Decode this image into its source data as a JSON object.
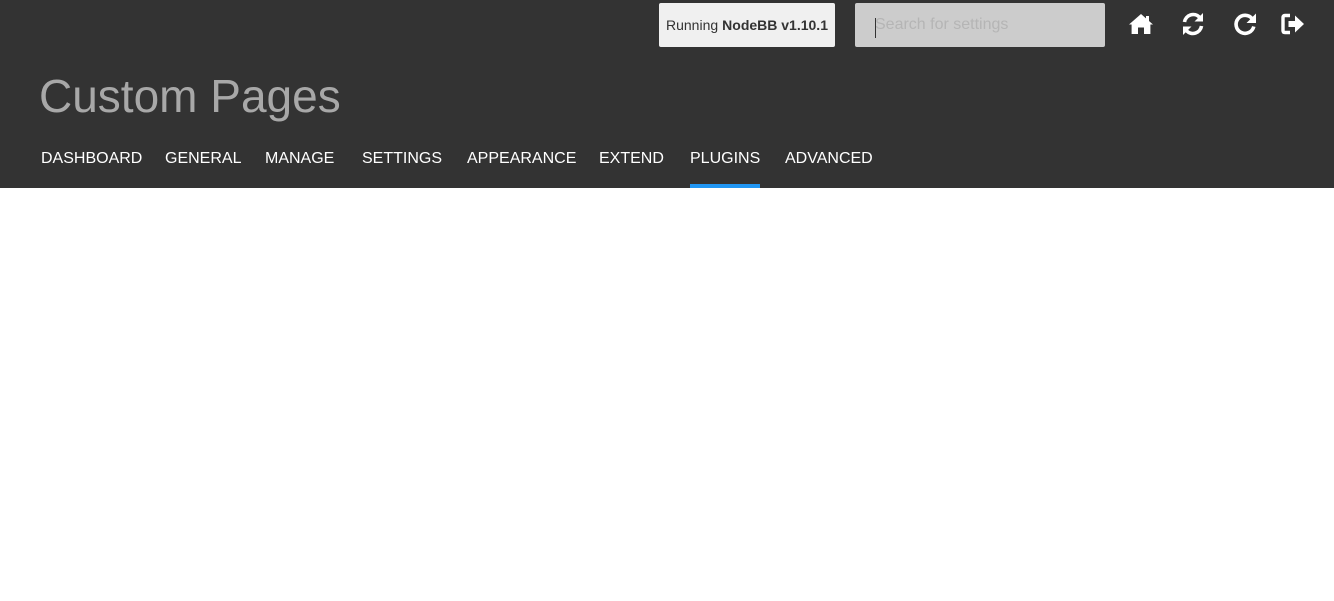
{
  "header": {
    "version": {
      "prefix": "Running",
      "product": "NodeBB v1.10.1"
    },
    "search": {
      "placeholder": "Search for settings",
      "value": ""
    },
    "icons": [
      {
        "name": "home-icon"
      },
      {
        "name": "rebuild-restart-icon"
      },
      {
        "name": "reload-icon"
      },
      {
        "name": "logout-icon"
      }
    ],
    "accent_color": "#2196f3",
    "background_color": "#333333"
  },
  "page": {
    "title": "Custom Pages"
  },
  "nav": {
    "items": [
      {
        "label": "DASHBOARD"
      },
      {
        "label": "GENERAL"
      },
      {
        "label": "MANAGE"
      },
      {
        "label": "SETTINGS"
      },
      {
        "label": "APPEARANCE"
      },
      {
        "label": "EXTEND"
      },
      {
        "label": "PLUGINS",
        "active": true
      },
      {
        "label": "ADVANCED"
      }
    ]
  }
}
